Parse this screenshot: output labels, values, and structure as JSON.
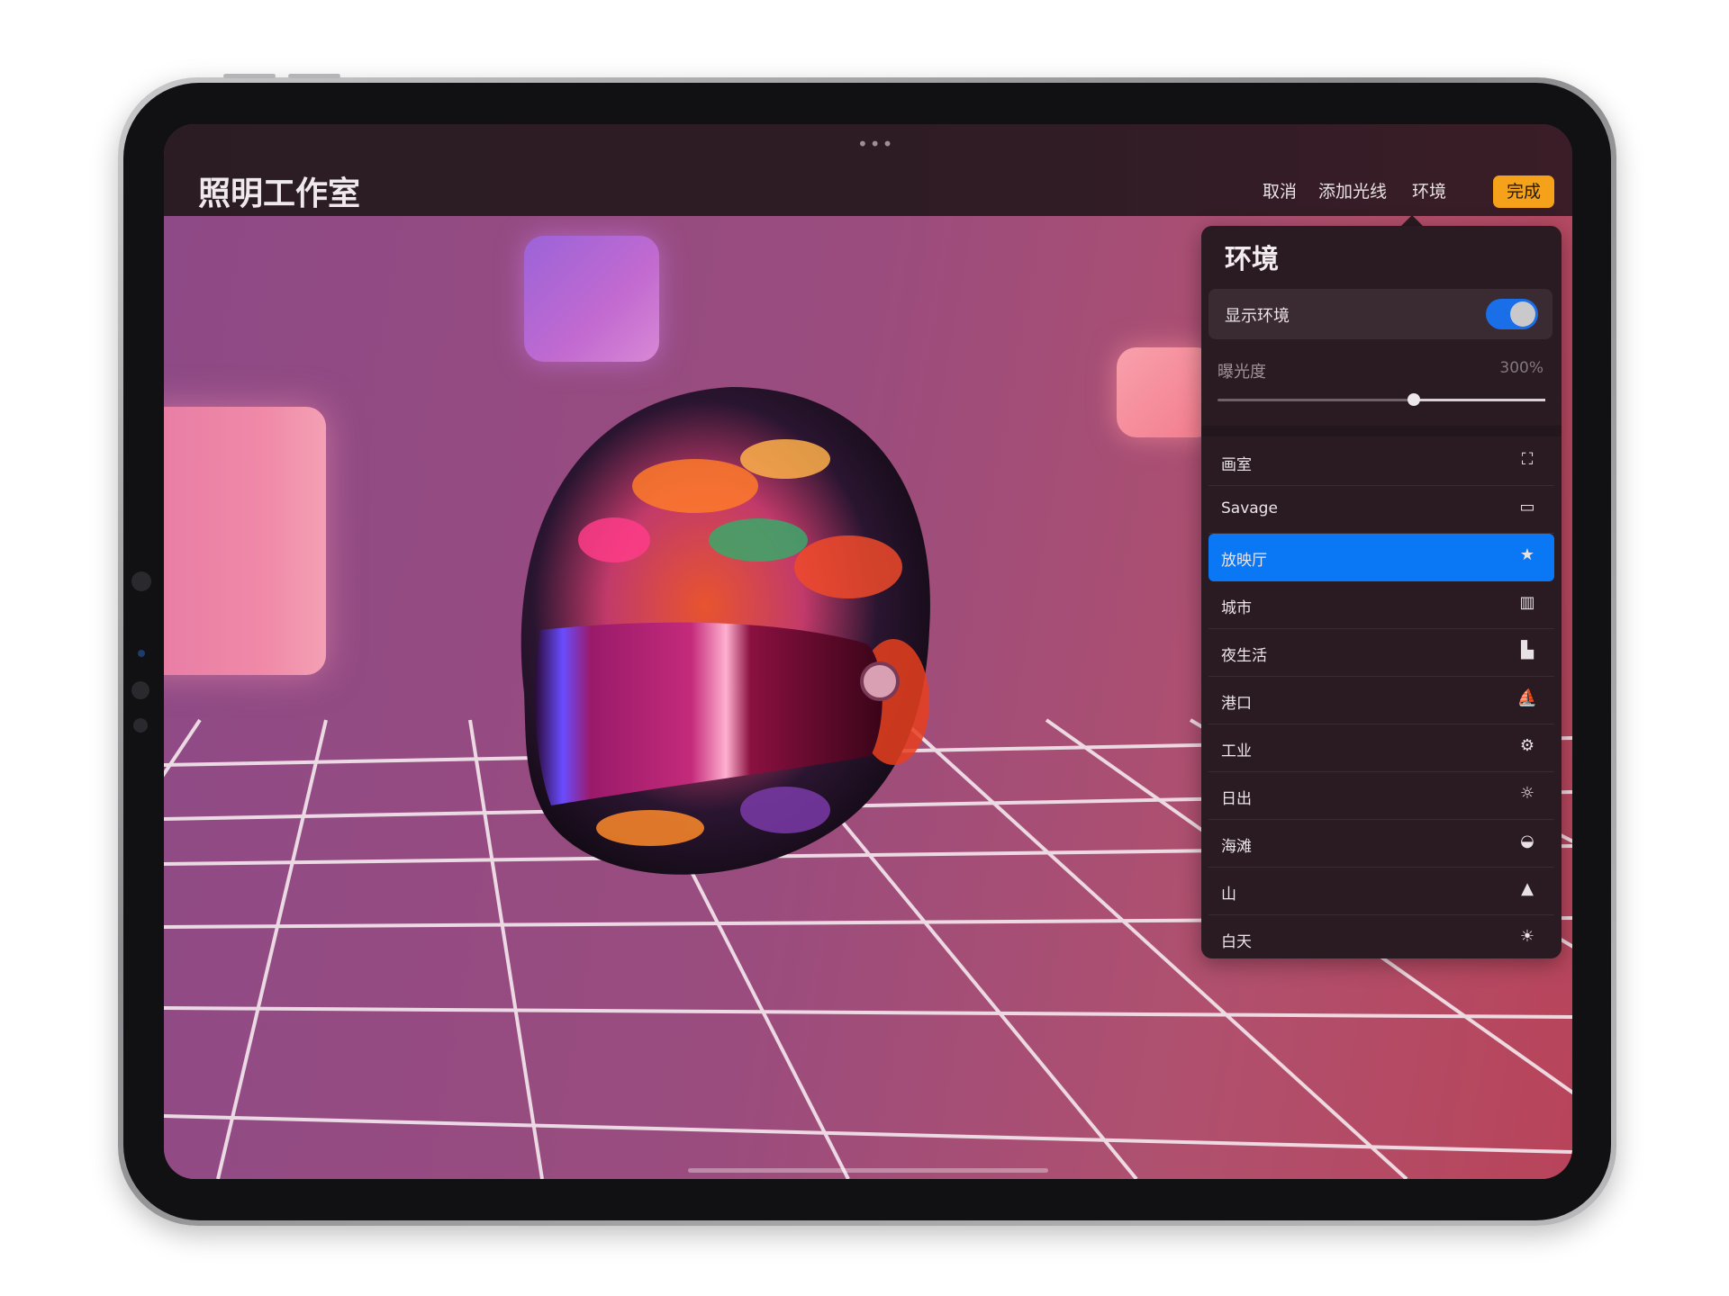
{
  "app": {
    "title": "照明工作室",
    "grabber": "•••"
  },
  "toolbar": {
    "cancel_label": "取消",
    "add_light_label": "添加光线",
    "environment_label": "环境",
    "done_label": "完成"
  },
  "environment_panel": {
    "title": "环境",
    "show_environment_label": "显示环境",
    "show_environment_on": true,
    "exposure_label": "曝光度",
    "exposure_value": "300%",
    "exposure_fraction": 0.6,
    "items": [
      {
        "label": "画室",
        "icon": "studio-icon",
        "selected": false
      },
      {
        "label": "Savage",
        "icon": "monitor-icon",
        "selected": false
      },
      {
        "label": "放映厅",
        "icon": "theater-icon",
        "selected": true
      },
      {
        "label": "城市",
        "icon": "city-icon",
        "selected": false
      },
      {
        "label": "夜生活",
        "icon": "nightlife-icon",
        "selected": false
      },
      {
        "label": "港口",
        "icon": "sailboat-icon",
        "selected": false
      },
      {
        "label": "工业",
        "icon": "gears-icon",
        "selected": false
      },
      {
        "label": "日出",
        "icon": "sunrise-icon",
        "selected": false
      },
      {
        "label": "海滩",
        "icon": "shell-icon",
        "selected": false
      },
      {
        "label": "山",
        "icon": "mountain-icon",
        "selected": false
      },
      {
        "label": "白天",
        "icon": "sun-icon",
        "selected": false
      }
    ]
  },
  "colors": {
    "accent_done": "#f5a21a",
    "selection_blue": "#0a78f5",
    "toggle_blue": "#1a6ee8"
  }
}
